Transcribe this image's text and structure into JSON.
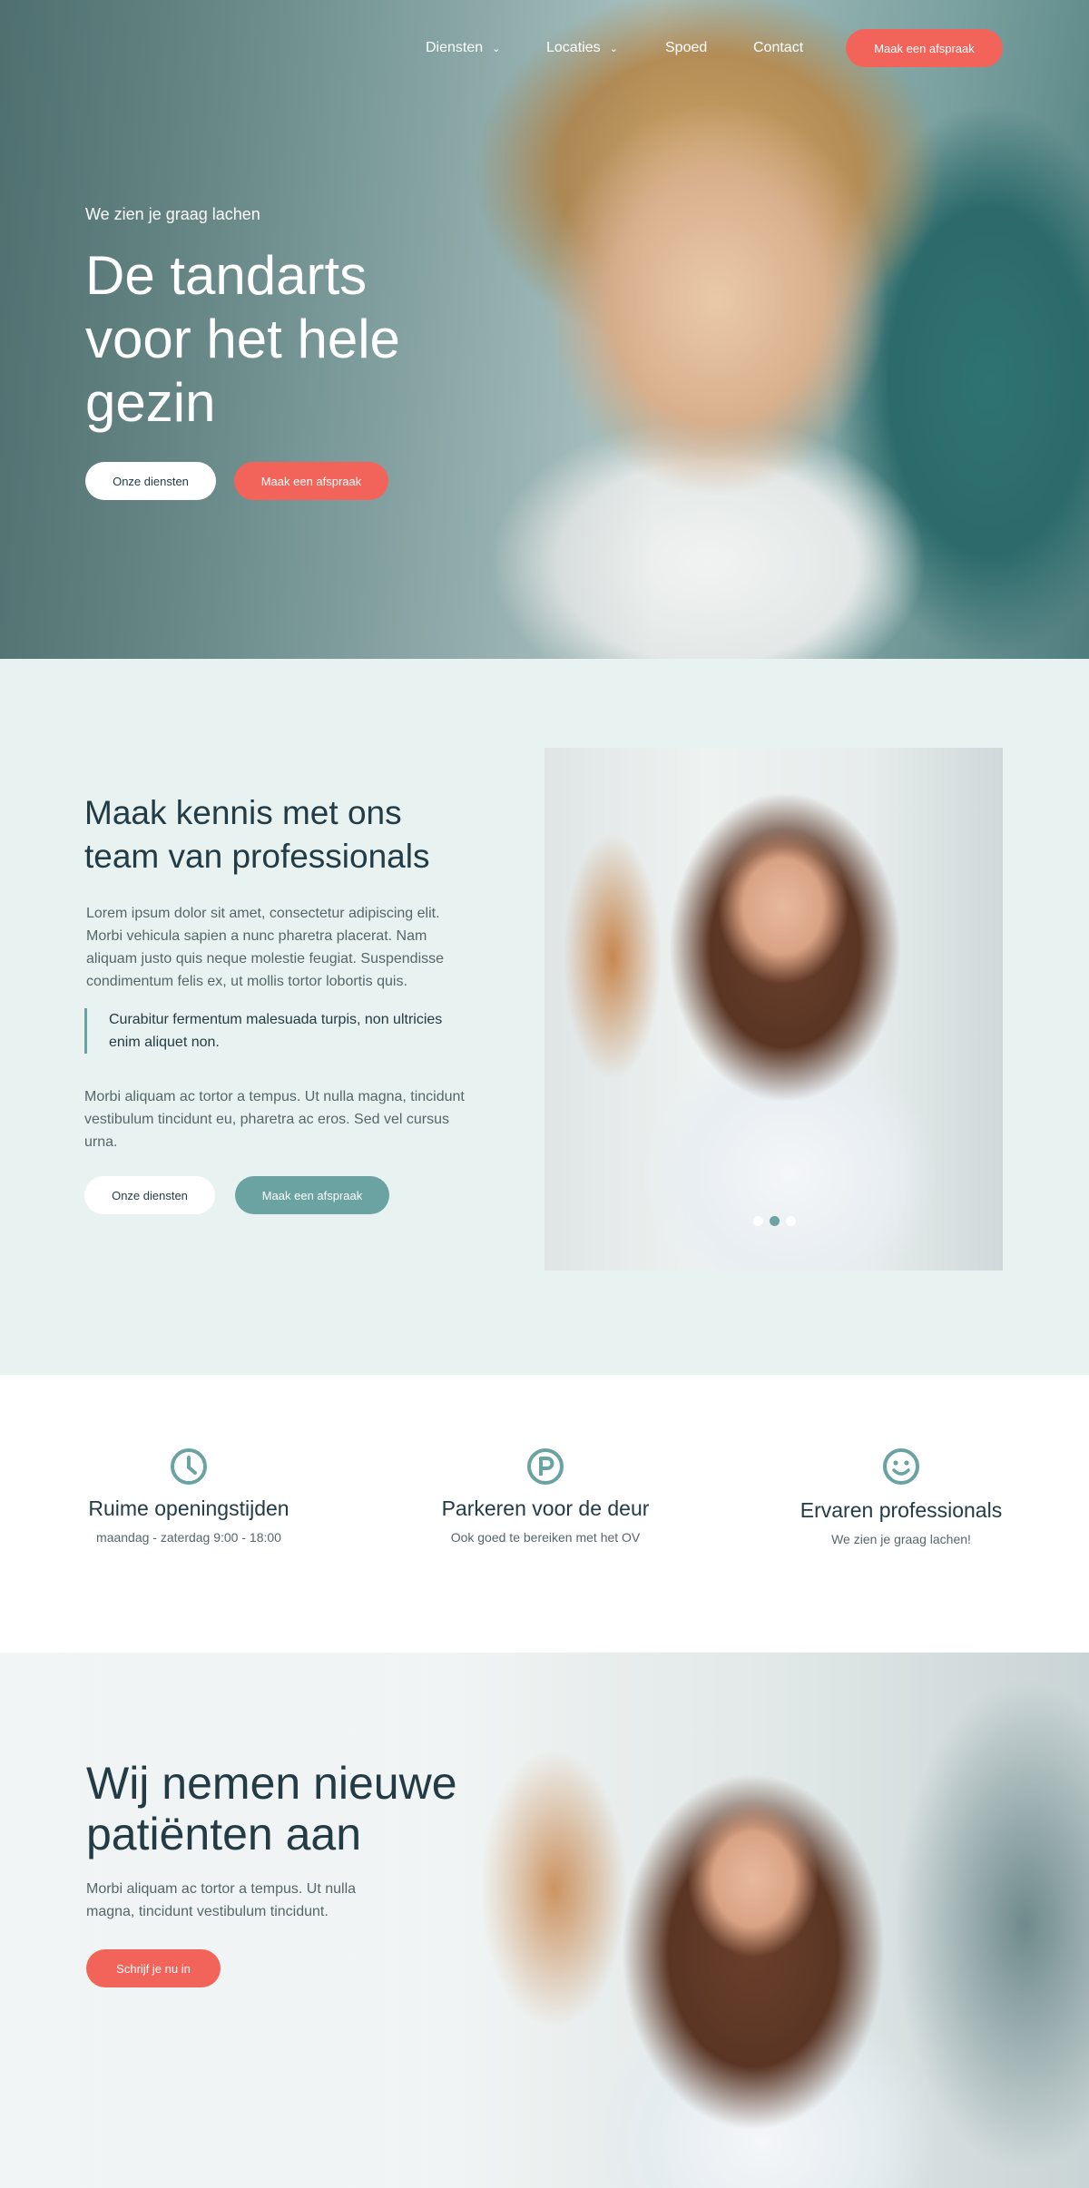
{
  "nav": {
    "items": [
      {
        "label": "Diensten",
        "has_dropdown": true
      },
      {
        "label": "Locaties",
        "has_dropdown": true
      },
      {
        "label": "Spoed",
        "has_dropdown": false
      },
      {
        "label": "Contact",
        "has_dropdown": false
      }
    ],
    "chevron": "⌄",
    "cta_label": "Maak een afspraak"
  },
  "hero": {
    "eyebrow": "We zien je graag lachen",
    "title": "De tandarts voor het hele gezin",
    "btn_services": "Onze diensten",
    "btn_appointment": "Maak een afspraak"
  },
  "team": {
    "title": "Maak kennis met ons team van professionals",
    "paragraph1": "Lorem ipsum dolor sit amet, consectetur adipiscing elit. Morbi vehicula sapien a nunc pharetra placerat. Nam aliquam justo quis neque molestie feugiat. Suspendisse condimentum felis ex, ut mollis tortor lobortis quis.",
    "quote": "Curabitur fermentum malesuada turpis, non ultricies enim aliquet non.",
    "paragraph2": "Morbi aliquam ac tortor a tempus. Ut nulla magna, tincidunt vestibulum tincidunt eu, pharetra ac eros. Sed vel cursus urna.",
    "btn_services": "Onze diensten",
    "btn_appointment": "Maak een afspraak",
    "slider": {
      "count": 3,
      "active_index": 1
    }
  },
  "features": [
    {
      "icon": "clock-icon",
      "title": "Ruime openingstijden",
      "subtitle": "maandag - zaterdag 9:00 - 18:00"
    },
    {
      "icon": "parking-icon",
      "title": "Parkeren voor de deur",
      "subtitle": "Ook goed te bereiken met het OV"
    },
    {
      "icon": "smiley-icon",
      "title": "Ervaren professionals",
      "subtitle": "We zien je graag lachen!"
    }
  ],
  "new_patients": {
    "title": "Wij nemen nieuwe patiënten aan",
    "text": "Morbi aliquam ac tortor a tempus. Ut nulla magna, tincidunt vestibulum tincidunt.",
    "btn_label": "Schrijf je nu in"
  },
  "colors": {
    "coral": "#f2645a",
    "teal": "#6aa3a2",
    "dark": "#233b44",
    "mint_bg": "#e8f2f1"
  }
}
